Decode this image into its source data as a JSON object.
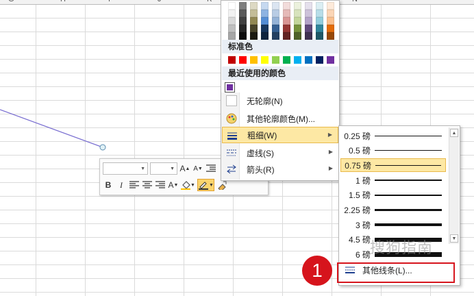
{
  "sheet": {
    "columns": [
      "G",
      "H",
      "I",
      "J",
      "K",
      "N"
    ]
  },
  "outline_menu": {
    "standard_colors_label": "标准色",
    "recent_colors_label": "最近使用的颜色",
    "no_outline": "无轮廓(N)",
    "more_colors": "其他轮廓颜色(M)...",
    "weight": "粗细(W)",
    "dashes": "虚线(S)",
    "arrows": "箭头(R)",
    "theme_colors": [
      [
        "#ffffff",
        "#f2f2f2",
        "#d9d9d9",
        "#bfbfbf",
        "#a6a6a6"
      ],
      [
        "#7f7f7f",
        "#595959",
        "#404040",
        "#262626",
        "#0d0d0d"
      ],
      [
        "#ddd9c3",
        "#c4bd97",
        "#938953",
        "#494429",
        "#1d1b10"
      ],
      [
        "#c6d9f0",
        "#8db3e2",
        "#548dd4",
        "#17365d",
        "#0f243e"
      ],
      [
        "#dbe5f1",
        "#b8cce4",
        "#95b3d7",
        "#366092",
        "#244061"
      ],
      [
        "#f2dcdb",
        "#e5b9b7",
        "#d99694",
        "#953734",
        "#632423"
      ],
      [
        "#ebf1dd",
        "#d7e3bc",
        "#c3d69b",
        "#76923c",
        "#4f6128"
      ],
      [
        "#e5e0ec",
        "#ccc1d9",
        "#b2a2c7",
        "#5f497a",
        "#3f3151"
      ],
      [
        "#dbeef3",
        "#b7dde8",
        "#92cddc",
        "#31859b",
        "#205867"
      ],
      [
        "#fdeada",
        "#fbd5b5",
        "#fac08f",
        "#e36c09",
        "#974806"
      ]
    ],
    "standard_colors": [
      "#c00000",
      "#ff0000",
      "#ffc000",
      "#ffff00",
      "#92d050",
      "#00b050",
      "#00b0f0",
      "#0070c0",
      "#002060",
      "#7030a0"
    ],
    "recent_colors": [
      "#7030a0"
    ]
  },
  "weight_menu": {
    "options": [
      {
        "label": "0.25 磅",
        "weight": 0.25
      },
      {
        "label": "0.5 磅",
        "weight": 0.5
      },
      {
        "label": "0.75 磅",
        "weight": 0.75
      },
      {
        "label": "1 磅",
        "weight": 1
      },
      {
        "label": "1.5 磅",
        "weight": 1.5
      },
      {
        "label": "2.25 磅",
        "weight": 2.25
      },
      {
        "label": "3 磅",
        "weight": 3
      },
      {
        "label": "4.5 磅",
        "weight": 4.5
      },
      {
        "label": "6 磅",
        "weight": 6
      }
    ],
    "selected_index": 2,
    "more_lines": "其他线条(L)..."
  },
  "annotation": {
    "step_number": "1"
  },
  "watermark": "搜狗指南"
}
